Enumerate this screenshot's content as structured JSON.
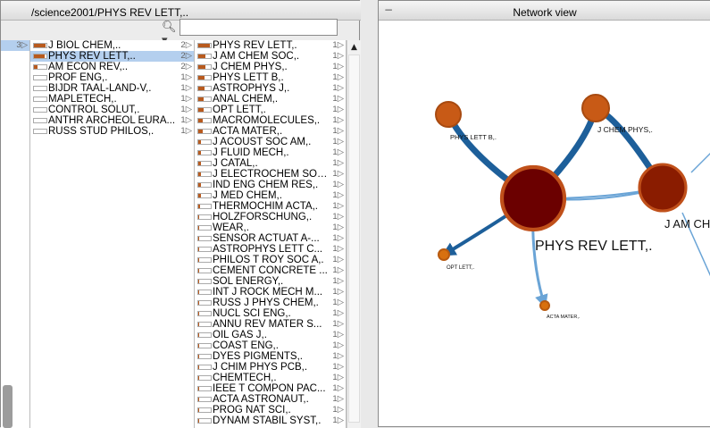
{
  "browser": {
    "path": "/science2001/PHYS REV LETT,..",
    "search": {
      "value": "",
      "placeholder": ""
    },
    "col0": [
      {
        "count": "3"
      }
    ],
    "col1": [
      {
        "label": "J BIOL CHEM,..",
        "count": "2",
        "bar": 0.9
      },
      {
        "label": "PHYS REV LETT,..",
        "count": "2",
        "bar": 0.85,
        "selected": true
      },
      {
        "label": "AM ECON REV,..",
        "count": "2",
        "bar": 0.3
      },
      {
        "label": "PROF ENG,.",
        "count": "1",
        "bar": 0
      },
      {
        "label": "BIJDR TAAL-LAND-V,.",
        "count": "1",
        "bar": 0
      },
      {
        "label": "MAPLETECH,.",
        "count": "1",
        "bar": 0
      },
      {
        "label": "CONTROL SOLUT,.",
        "count": "1",
        "bar": 0
      },
      {
        "label": "ANTHR ARCHEOL EURA...",
        "count": "1",
        "bar": 0
      },
      {
        "label": "RUSS STUD PHILOS,.",
        "count": "1",
        "bar": 0
      }
    ],
    "col2": [
      {
        "label": "PHYS REV LETT,.",
        "count": "1",
        "bar": 0.95
      },
      {
        "label": "J AM CHEM SOC,.",
        "count": "1",
        "bar": 0.6
      },
      {
        "label": "J CHEM PHYS,.",
        "count": "1",
        "bar": 0.55
      },
      {
        "label": "PHYS LETT B,.",
        "count": "1",
        "bar": 0.5
      },
      {
        "label": "ASTROPHYS J,.",
        "count": "1",
        "bar": 0.5
      },
      {
        "label": "ANAL CHEM,.",
        "count": "1",
        "bar": 0.45
      },
      {
        "label": "OPT LETT,.",
        "count": "1",
        "bar": 0.4
      },
      {
        "label": "MACROMOLECULES,.",
        "count": "1",
        "bar": 0.35
      },
      {
        "label": "ACTA MATER,.",
        "count": "1",
        "bar": 0.35
      },
      {
        "label": "J ACOUST SOC AM,.",
        "count": "1",
        "bar": 0.2
      },
      {
        "label": "J FLUID MECH,.",
        "count": "1",
        "bar": 0.2
      },
      {
        "label": "J CATAL,.",
        "count": "1",
        "bar": 0.2
      },
      {
        "label": "J ELECTROCHEM SOC,.",
        "count": "1",
        "bar": 0.2
      },
      {
        "label": "IND ENG CHEM RES,.",
        "count": "1",
        "bar": 0.2
      },
      {
        "label": "J MED CHEM,.",
        "count": "1",
        "bar": 0.2
      },
      {
        "label": "THERMOCHIM ACTA,.",
        "count": "1",
        "bar": 0.12
      },
      {
        "label": "HOLZFORSCHUNG,.",
        "count": "1",
        "bar": 0.08
      },
      {
        "label": "WEAR,.",
        "count": "1",
        "bar": 0.08
      },
      {
        "label": "SENSOR ACTUAT A-...",
        "count": "1",
        "bar": 0.08
      },
      {
        "label": "ASTROPHYS LETT C...",
        "count": "1",
        "bar": 0.08
      },
      {
        "label": "PHILOS T ROY SOC A,.",
        "count": "1",
        "bar": 0.08
      },
      {
        "label": "CEMENT CONCRETE ...",
        "count": "1",
        "bar": 0.08
      },
      {
        "label": "SOL ENERGY,.",
        "count": "1",
        "bar": 0.08
      },
      {
        "label": "INT J ROCK MECH M...",
        "count": "1",
        "bar": 0.08
      },
      {
        "label": "RUSS J PHYS CHEM,.",
        "count": "1",
        "bar": 0.08
      },
      {
        "label": "NUCL SCI ENG,.",
        "count": "1",
        "bar": 0.08
      },
      {
        "label": "ANNU REV MATER S...",
        "count": "1",
        "bar": 0.08
      },
      {
        "label": "OIL GAS J,.",
        "count": "1",
        "bar": 0.08
      },
      {
        "label": "COAST ENG,.",
        "count": "1",
        "bar": 0.08
      },
      {
        "label": "DYES PIGMENTS,.",
        "count": "1",
        "bar": 0.08
      },
      {
        "label": "J CHIM PHYS PCB,.",
        "count": "1",
        "bar": 0.08
      },
      {
        "label": "CHEMTECH,.",
        "count": "1",
        "bar": 0.08
      },
      {
        "label": "IEEE T COMPON PAC...",
        "count": "1",
        "bar": 0.08
      },
      {
        "label": "ACTA ASTRONAUT,.",
        "count": "1",
        "bar": 0.08
      },
      {
        "label": "PROG NAT SCI,.",
        "count": "1",
        "bar": 0.08
      },
      {
        "label": "DYNAM STABIL SYST,.",
        "count": "1",
        "bar": 0.08
      }
    ]
  },
  "network": {
    "title": "Network view",
    "nodes": [
      {
        "id": "prl",
        "label": "PHYS REV LETT,.",
        "color": "#6b0000",
        "ring": "#c0501a"
      },
      {
        "id": "jacs",
        "label": "J AM CH",
        "color": "#8a1c00",
        "ring": "#c0501a"
      },
      {
        "id": "plb",
        "label": "PHYS LETT B,.",
        "color": "#c85a16",
        "ring": "#a84a10"
      },
      {
        "id": "jcp",
        "label": "J CHEM PHYS,.",
        "color": "#c85a16",
        "ring": "#a84a10"
      },
      {
        "id": "optl",
        "label": "OPT LETT,.",
        "color": "#d8700f",
        "ring": "#b85a10"
      },
      {
        "id": "acta",
        "label": "ACTA MATER,.",
        "color": "#d8700f",
        "ring": "#b85a10"
      }
    ],
    "colors": {
      "edge_dark": "#1d5f9a",
      "edge_light": "#6aa4d6"
    }
  }
}
